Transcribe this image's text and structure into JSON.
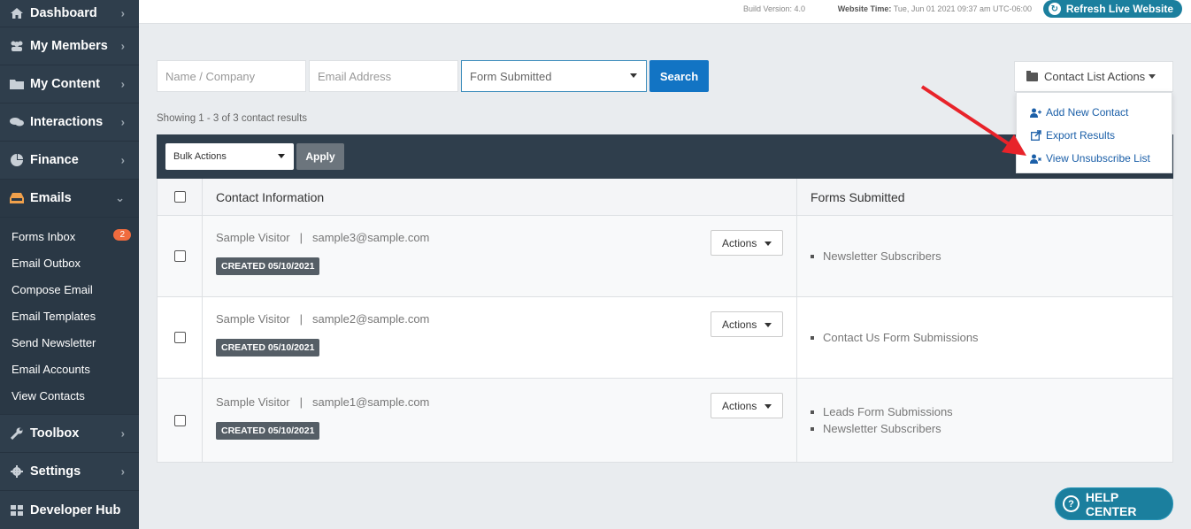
{
  "sidebar": {
    "items": [
      {
        "label": "Dashboard",
        "icon": "home-icon"
      },
      {
        "label": "My Members",
        "icon": "users-icon"
      },
      {
        "label": "My Content",
        "icon": "folder-icon"
      },
      {
        "label": "Interactions",
        "icon": "comments-icon"
      },
      {
        "label": "Finance",
        "icon": "pie-chart-icon"
      },
      {
        "label": "Emails",
        "icon": "inbox-icon"
      }
    ],
    "emails_submenu": [
      {
        "label": "Forms Inbox",
        "badge": "2"
      },
      {
        "label": "Email Outbox"
      },
      {
        "label": "Compose Email"
      },
      {
        "label": "Email Templates"
      },
      {
        "label": "Send Newsletter"
      },
      {
        "label": "Email Accounts"
      },
      {
        "label": "View Contacts"
      }
    ],
    "bottom_items": [
      {
        "label": "Toolbox",
        "icon": "wrench-icon"
      },
      {
        "label": "Settings",
        "icon": "gear-icon"
      },
      {
        "label": "Developer Hub",
        "icon": "grid-icon"
      }
    ]
  },
  "topbar": {
    "build": "Build Version: 4.0",
    "website_time_label": "Website Time:",
    "website_time_value": "Tue, Jun 01 2021 09:37 am UTC-06:00",
    "refresh_label": "Refresh Live Website"
  },
  "filters": {
    "name_placeholder": "Name / Company",
    "email_placeholder": "Email Address",
    "form_select": "Form Submitted",
    "search_label": "Search"
  },
  "contact_list_actions": {
    "label": "Contact List Actions",
    "items": [
      {
        "label": "Add New Contact",
        "icon": "user-plus-icon"
      },
      {
        "label": "Export Results",
        "icon": "external-link-icon"
      },
      {
        "label": "View Unsubscribe List",
        "icon": "user-times-icon"
      }
    ]
  },
  "showing": "Showing 1 - 3 of 3 contact results",
  "bulk": {
    "label": "Bulk Actions",
    "apply": "Apply"
  },
  "table": {
    "headers": {
      "contact": "Contact Information",
      "forms": "Forms Submitted"
    },
    "rows": [
      {
        "name": "Sample Visitor",
        "email": "sample3@sample.com",
        "created": "CREATED 05/10/2021",
        "actions": "Actions",
        "forms": [
          "Newsletter Subscribers"
        ]
      },
      {
        "name": "Sample Visitor",
        "email": "sample2@sample.com",
        "created": "CREATED 05/10/2021",
        "actions": "Actions",
        "forms": [
          "Contact Us Form Submissions"
        ]
      },
      {
        "name": "Sample Visitor",
        "email": "sample1@sample.com",
        "created": "CREATED 05/10/2021",
        "actions": "Actions",
        "forms": [
          "Leads Form Submissions",
          "Newsletter Subscribers"
        ]
      }
    ]
  },
  "help_center": "HELP CENTER",
  "colors": {
    "sidebar": "#2f3e4c",
    "accent": "#1274c4",
    "teal": "#1b7f9e",
    "badge": "#f06b3e",
    "arrow": "#e8232a"
  }
}
